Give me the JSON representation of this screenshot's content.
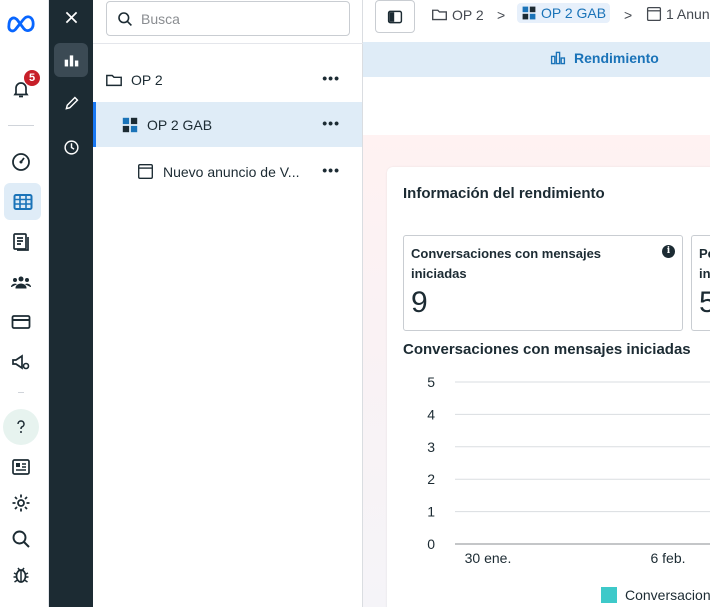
{
  "rail": {
    "notification_count": "5"
  },
  "tree": {
    "search_placeholder": "Busca",
    "items": [
      {
        "label": "OP 2",
        "icon": "folder-icon"
      },
      {
        "label": "OP 2 GAB",
        "icon": "ad-set-icon"
      },
      {
        "label": "Nuevo anuncio de V...",
        "icon": "ad-icon"
      }
    ],
    "more_label": "•••"
  },
  "header": {
    "breadcrumbs": [
      "OP 2",
      "OP 2 GAB",
      "1 Anun"
    ],
    "tab_label": "Rendimiento"
  },
  "performance": {
    "title": "Información del rendimiento",
    "metrics": [
      {
        "label_line1": "Conversaciones con mensajes",
        "label_line2": "iniciadas",
        "value": "9"
      },
      {
        "label_line1": "Pe",
        "label_line2": "in",
        "value": "5"
      }
    ],
    "info_glyph": "i"
  },
  "chart_data": {
    "type": "line",
    "title": "Conversaciones con mensajes iniciadas",
    "y_ticks": [
      "5",
      "4",
      "3",
      "2",
      "1",
      "0"
    ],
    "ylim": [
      0,
      5
    ],
    "x_ticks": [
      "30 ene.",
      "6 feb."
    ],
    "grid": true,
    "legend": "bottom",
    "series": [
      {
        "name": "Conversacion",
        "color": "#3ec9c9"
      }
    ]
  },
  "colors": {
    "accent": "#1a73b8",
    "selected_bg": "#dfecf7",
    "dark_sidebar": "#1c2b33",
    "badge": "#c71f29",
    "series": "#3ec9c9"
  }
}
